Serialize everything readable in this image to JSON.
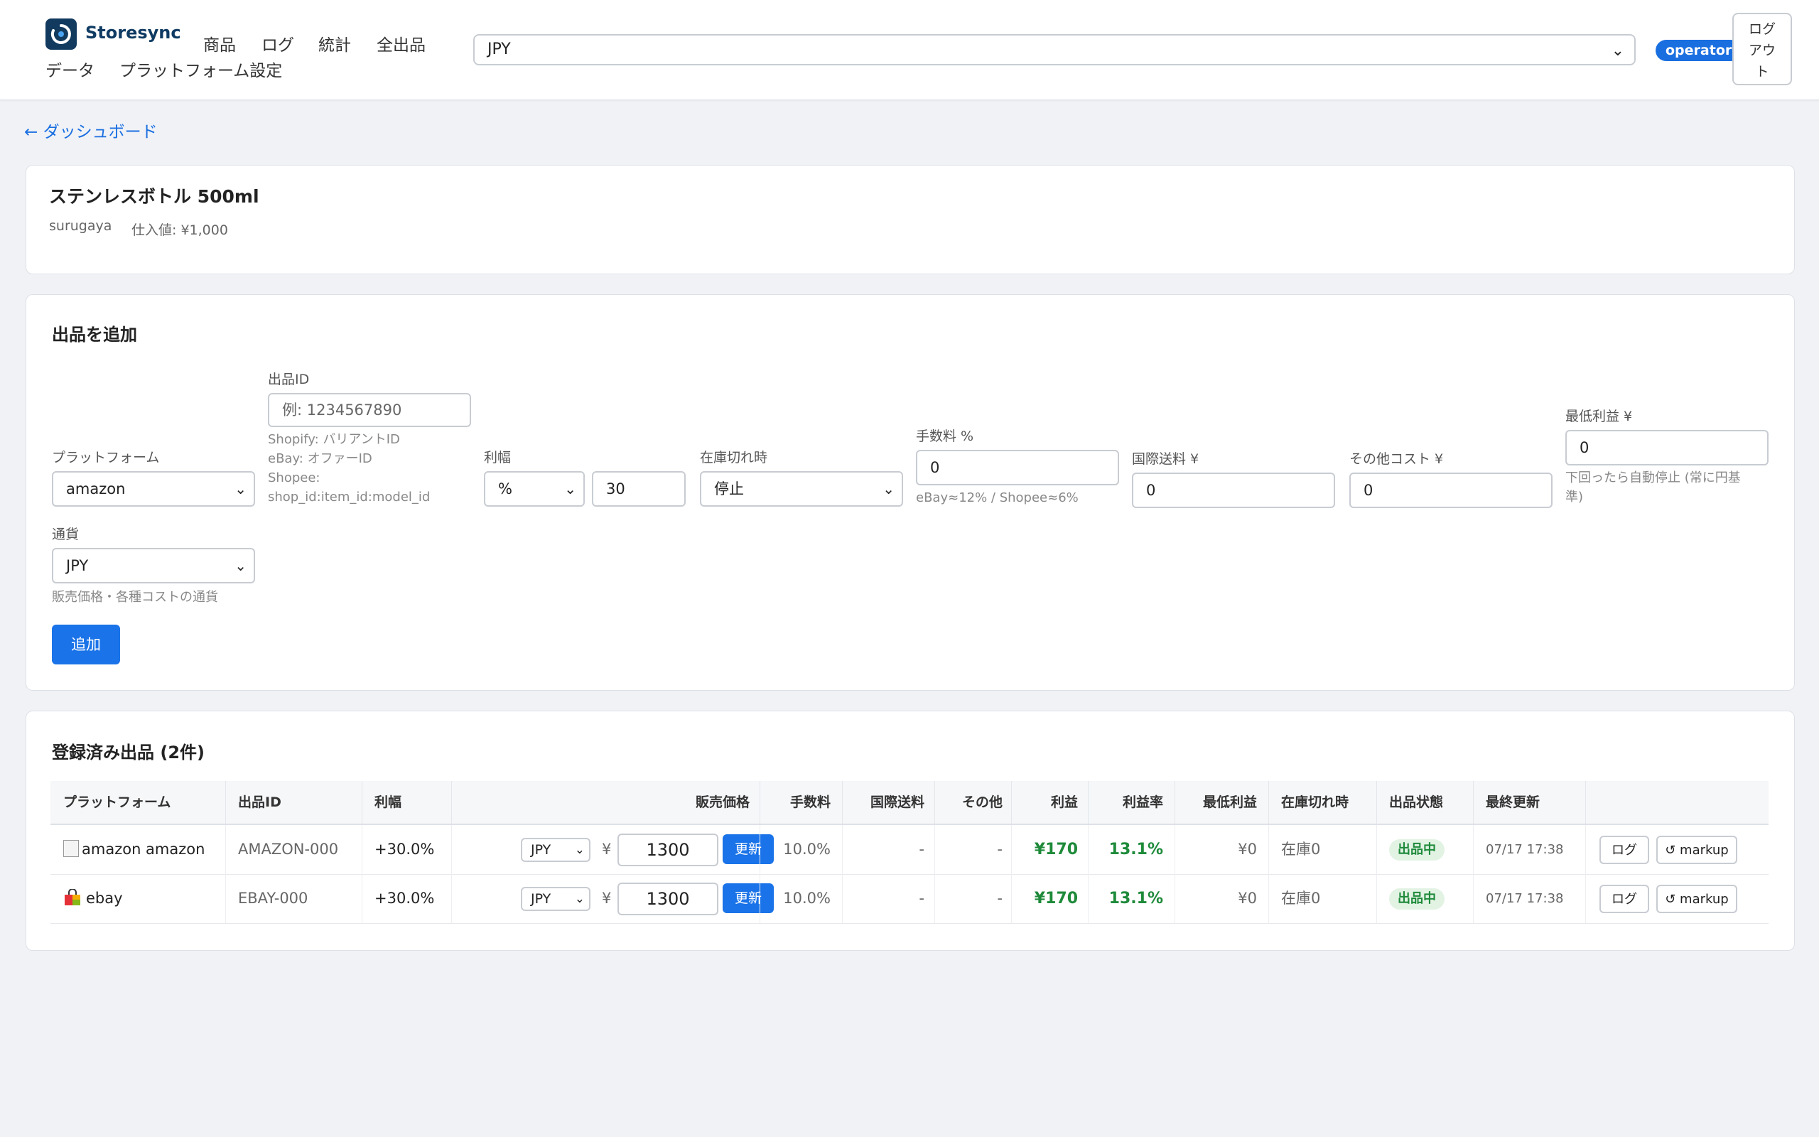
{
  "header": {
    "brand": "Storesync",
    "nav": [
      "商品",
      "ログ",
      "統計",
      "全出品",
      "データ",
      "プラットフォーム設定"
    ],
    "currency": "JPY",
    "role": "operator",
    "logout": [
      "ログ",
      "アウ",
      "ト"
    ]
  },
  "back_link": "← ダッシュボード",
  "product": {
    "title": "ステンレスボトル 500ml",
    "source": "surugaya",
    "cost": "仕入値: ¥1,000"
  },
  "add_form": {
    "title": "出品を追加",
    "platform_label": "プラットフォーム",
    "platform_value": "amazon",
    "listing_id_label": "出品ID",
    "listing_id_placeholder": "例: 1234567890",
    "listing_id_hints": [
      "Shopify: バリアントID",
      "eBay: オファーID",
      "Shopee:",
      "shop_id:item_id:model_id"
    ],
    "margin_label": "利幅",
    "margin_type": "%",
    "margin_value": "30",
    "oos_label": "在庫切れ時",
    "oos_value": "停止",
    "fee_label": "手数料 %",
    "fee_value": "0",
    "fee_hint": "eBay≈12% / Shopee≈6%",
    "intl_label": "国際送料 ¥",
    "intl_value": "0",
    "other_label": "その他コスト ¥",
    "other_value": "0",
    "min_profit_label": "最低利益 ¥",
    "min_profit_value": "0",
    "min_profit_hint": [
      "下回ったら自動停止 (常に円基",
      "準)"
    ],
    "currency_label": "通貨",
    "currency_value": "JPY",
    "currency_hint": "販売価格・各種コストの通貨",
    "add_button": "追加"
  },
  "listings": {
    "title": "登録済み出品 (2件)",
    "columns": [
      "プラットフォーム",
      "出品ID",
      "利幅",
      "販売価格",
      "手数料",
      "国際送料",
      "その他",
      "利益",
      "利益率",
      "最低利益",
      "在庫切れ時",
      "出品状態",
      "最終更新"
    ],
    "rows": [
      {
        "platform": "amazon amazon",
        "icon": "broken-image-icon",
        "listing_id": "AMAZON-000",
        "margin": "+30.0%",
        "currency": "JPY",
        "yen": "¥",
        "price": "1300",
        "update": "更新",
        "fee": "10.0%",
        "intl": "-",
        "other": "-",
        "profit": "¥170",
        "profit_rate": "13.1%",
        "min_profit": "¥0",
        "oos": "在庫0",
        "status": "出品中",
        "updated": "07/17 17:38",
        "log_btn": "ログ",
        "markup_btn": "↺ markup"
      },
      {
        "platform": "ebay",
        "icon": "shopping-bag-icon",
        "listing_id": "EBAY-000",
        "margin": "+30.0%",
        "currency": "JPY",
        "yen": "¥",
        "price": "1300",
        "update": "更新",
        "fee": "10.0%",
        "intl": "-",
        "other": "-",
        "profit": "¥170",
        "profit_rate": "13.1%",
        "min_profit": "¥0",
        "oos": "在庫0",
        "status": "出品中",
        "updated": "07/17 17:38",
        "log_btn": "ログ",
        "markup_btn": "↺ markup"
      }
    ]
  }
}
